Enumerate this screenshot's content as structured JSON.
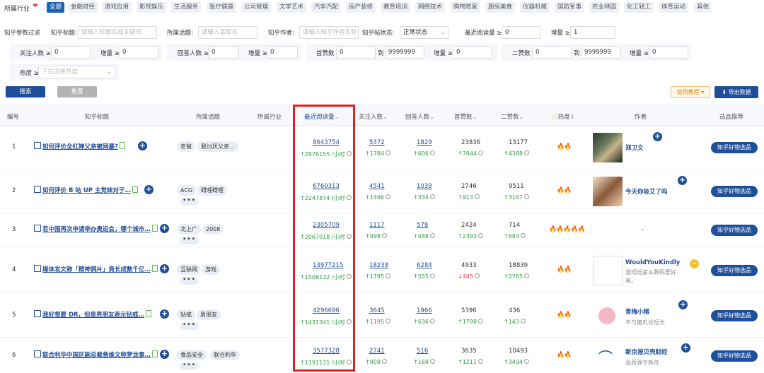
{
  "categories": {
    "label": "所属行业",
    "items": [
      "全部",
      "金融财经",
      "游戏应用",
      "影视娱乐",
      "生活服务",
      "医疗健康",
      "公司管理",
      "文学艺术",
      "汽车汽配",
      "房产装修",
      "教育培训",
      "网络技术",
      "购物败家",
      "厨房美食",
      "仪器机械",
      "国防军事",
      "农业林园",
      "化工轻工",
      "体育运动",
      "其他"
    ]
  },
  "filters": {
    "section_label": "知乎参数过滤",
    "title_label": "知乎标题:",
    "title_placeholder": "请输入标题名或关键词",
    "topic_label": "所属话题:",
    "topic_placeholder": "请输入话题名",
    "author_label": "知乎作者:",
    "author_placeholder": "请输入知乎作者名称",
    "status_label": "知乎帖状态:",
    "status_value": "正常状态",
    "recent_read_label": "最近阅读量 ≥",
    "recent_read_value": "0",
    "increase_label": "增量 ≥",
    "increase_value": "1",
    "follow_label": "关注人数 ≥",
    "follow_value": "0",
    "follow_inc_label": "增量 ≥",
    "follow_inc_value": "0",
    "answer_label": "回答人数 ≥",
    "answer_value": "0",
    "answer_inc_label": "增量 ≥",
    "answer_inc_value": "0",
    "likes_label": "首赞数",
    "likes_from": "0",
    "likes_to_label": "到",
    "likes_to": "9999999",
    "likes_inc_label": "增量 ≥",
    "likes_inc_value": "0",
    "second_label": "二赞数",
    "second_from": "0",
    "second_to_label": "到",
    "second_to": "9999999",
    "second_inc_label": "增量 ≥",
    "second_inc_value": "0",
    "heat_label": "热度 ≥",
    "heat_placeholder": "下拉选择热度"
  },
  "actions": {
    "search": "搜索",
    "reset": "重置",
    "tutorial": "使用教程 ▾",
    "export": "导出数据"
  },
  "table": {
    "headers": {
      "index": "编号",
      "title": "知乎标题",
      "topic": "所属话题",
      "industry": "所属行业",
      "recent_read": "最近阅读量",
      "follow": "关注人数",
      "answer": "回答人数",
      "likes": "首赞数",
      "second": "二赞数",
      "heat": "热度",
      "author": "作者",
      "pick": "选品推荐"
    },
    "rows": [
      {
        "index": "1",
        "title": "如何评价全红婵父亲被网暴?",
        "tags": [
          "老爸",
          "我讨厌父亲…"
        ],
        "industry": "",
        "read": "8643754",
        "read_inc": "2876155 /小时",
        "follow": "5372",
        "follow_inc": "1784",
        "answer": "1829",
        "answer_inc": "606",
        "likes": "23836",
        "likes_inc": "7944",
        "second": "13177",
        "second_inc": "4388",
        "heat": "🔥🔥",
        "author": "郑卫文",
        "author_sub": "",
        "pick": "知乎好物选品"
      },
      {
        "index": "2",
        "title": "如何评价 B 站 UP 主觉妹对于…",
        "tags": [
          "ACG",
          "碍哩碍哩"
        ],
        "industry": "",
        "read": "6769313",
        "read_inc": "2247874 /小时",
        "follow": "4541",
        "follow_inc": "1496",
        "answer": "1039",
        "answer_inc": "334",
        "likes": "2746",
        "likes_inc": "913",
        "second": "9511",
        "second_inc": "3167",
        "heat": "🔥🔥",
        "author": "今天你吸艾了吗",
        "author_sub": "",
        "pick": "知乎好物选品"
      },
      {
        "index": "3",
        "title": "若中国再次申请举办奥运会，哪个城市…",
        "tags": [
          "北上广",
          "2008"
        ],
        "industry": "",
        "read": "2305709",
        "read_inc": "2067018 /小时",
        "follow": "1117",
        "follow_inc": "998",
        "answer": "578",
        "answer_inc": "488",
        "likes": "2424",
        "likes_inc": "2393",
        "second": "714",
        "second_inc": "684",
        "heat": "🔥🔥🔥🔥🔥",
        "author": "-",
        "author_sub": "",
        "pick": "知乎好物选品"
      },
      {
        "index": "4",
        "title": "媒体发文称「精神鸦片」竟长成数千亿…",
        "tags": [
          "互联网",
          "游戏"
        ],
        "industry": "",
        "read": "13977215",
        "read_inc": "1506132 /小时",
        "follow": "18238",
        "follow_inc": "1795",
        "answer": "6284",
        "answer_inc": "555",
        "likes": "4933",
        "likes_inc": "445",
        "second": "18839",
        "second_inc": "2765",
        "heat": "🔥🔥",
        "author": "WouldYouKindly",
        "author_sub": "游戏玩家＆数码爱好者。",
        "pick": "知乎好物选品"
      },
      {
        "index": "5",
        "title": "我好想要 DR，但是男朋友表示钻戒…",
        "tags": [
          "钻戒",
          "男朋友"
        ],
        "industry": "",
        "read": "4296696",
        "read_inc": "1431341 /小时",
        "follow": "3645",
        "follow_inc": "1195",
        "answer": "1966",
        "answer_inc": "636",
        "likes": "5396",
        "likes_inc": "1798",
        "second": "436",
        "second_inc": "143",
        "heat": "🔥🔥",
        "author": "青梅小猪",
        "author_sub": "不与傻瓜论短长",
        "pick": "知乎好物选品"
      },
      {
        "index": "6",
        "title": "联合利华中国区副总裁曾维文称梦龙事…",
        "tags": [
          "食品安全",
          "联合利华"
        ],
        "industry": "",
        "read": "3577328",
        "read_inc": "1191131 /小时",
        "follow": "2741",
        "follow_inc": "908",
        "answer": "516",
        "answer_inc": "168",
        "likes": "3635",
        "likes_inc": "1211",
        "second": "10493",
        "second_inc": "3494",
        "heat": "🔥🔥",
        "author": "新京报贝壳财经",
        "author_sub": "品质源于新任",
        "pick": "知乎好物选品"
      }
    ]
  },
  "colors": {
    "accent": "#1f4f98",
    "up": "#2ea043",
    "down": "#e33333",
    "highlight": "#e02020"
  }
}
